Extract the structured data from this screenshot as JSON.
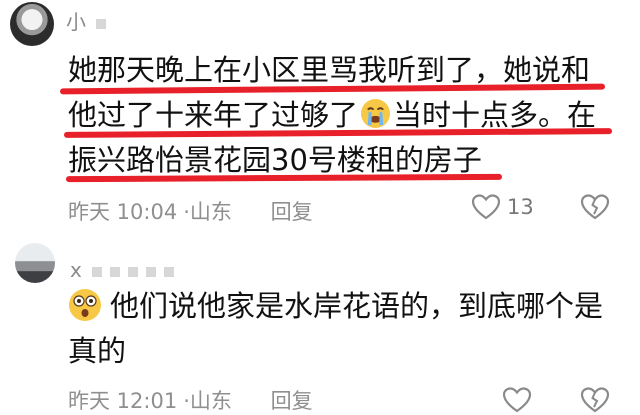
{
  "comments": [
    {
      "username": "小",
      "lines": [
        "她那天晚上在小区里骂我听到了，她说和",
        "他过了十来年了过够了",
        "当时十点多。在",
        "振兴路怡景花园30号楼租的房子"
      ],
      "time": "昨天 10:04",
      "location": "山东",
      "reply_label": "回复",
      "like_count": "13",
      "colors": {
        "underline": "#e8202a"
      }
    },
    {
      "username": "x",
      "lines": [
        "他们说他家是水岸花语的，到底哪个是",
        "真的"
      ],
      "time": "昨天 12:01",
      "location": "山东",
      "reply_label": "回复",
      "like_count": ""
    }
  ]
}
